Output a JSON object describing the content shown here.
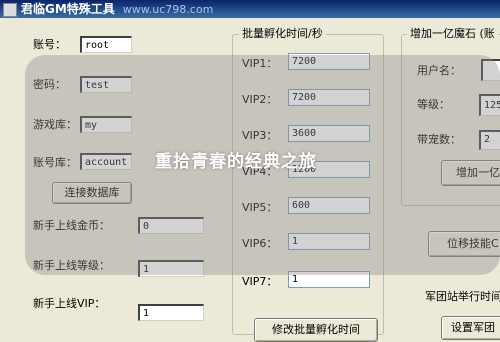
{
  "titlebar": {
    "title": "君临GM特殊工具",
    "watermark": "www.uc798.com"
  },
  "db": {
    "account_label": "账号：",
    "account_value": "root",
    "password_label": "密码：",
    "password_value": "test",
    "gamedb_label": "游戏库：",
    "gamedb_value": "my",
    "accountdb_label": "账号库：",
    "accountdb_value": "account",
    "connect_button": "连接数据库"
  },
  "newbie": {
    "gold_label": "新手上线金币：",
    "gold_value": "0",
    "level_label": "新手上线等级：",
    "level_value": "1",
    "vip_label": "新手上线VIP：",
    "vip_value": "1"
  },
  "hatch": {
    "group_title": "批量孵化时间/秒",
    "rows": [
      {
        "label": "VIP1：",
        "value": "7200"
      },
      {
        "label": "VIP2：",
        "value": "7200"
      },
      {
        "label": "VIP3：",
        "value": "3600"
      },
      {
        "label": "VIP4：",
        "value": "1200"
      },
      {
        "label": "VIP5：",
        "value": "600"
      },
      {
        "label": "VIP6：",
        "value": "1"
      },
      {
        "label": "VIP7：",
        "value": "1"
      }
    ],
    "modify_button": "修改批量孵化时间"
  },
  "magic": {
    "group_title": "增加一亿魔石 (账",
    "username_label": "用户名：",
    "username_value": "",
    "level_label": "等级：",
    "level_value": "125",
    "pets_label": "带宠数：",
    "pets_value": "2",
    "add_button": "增加一亿"
  },
  "right_misc": {
    "skill_button": "位移技能C",
    "legion_label": "军团站举行时间",
    "legion_button": "设置军团"
  },
  "overlay": {
    "caption": "重拾青春的经典之旅"
  }
}
